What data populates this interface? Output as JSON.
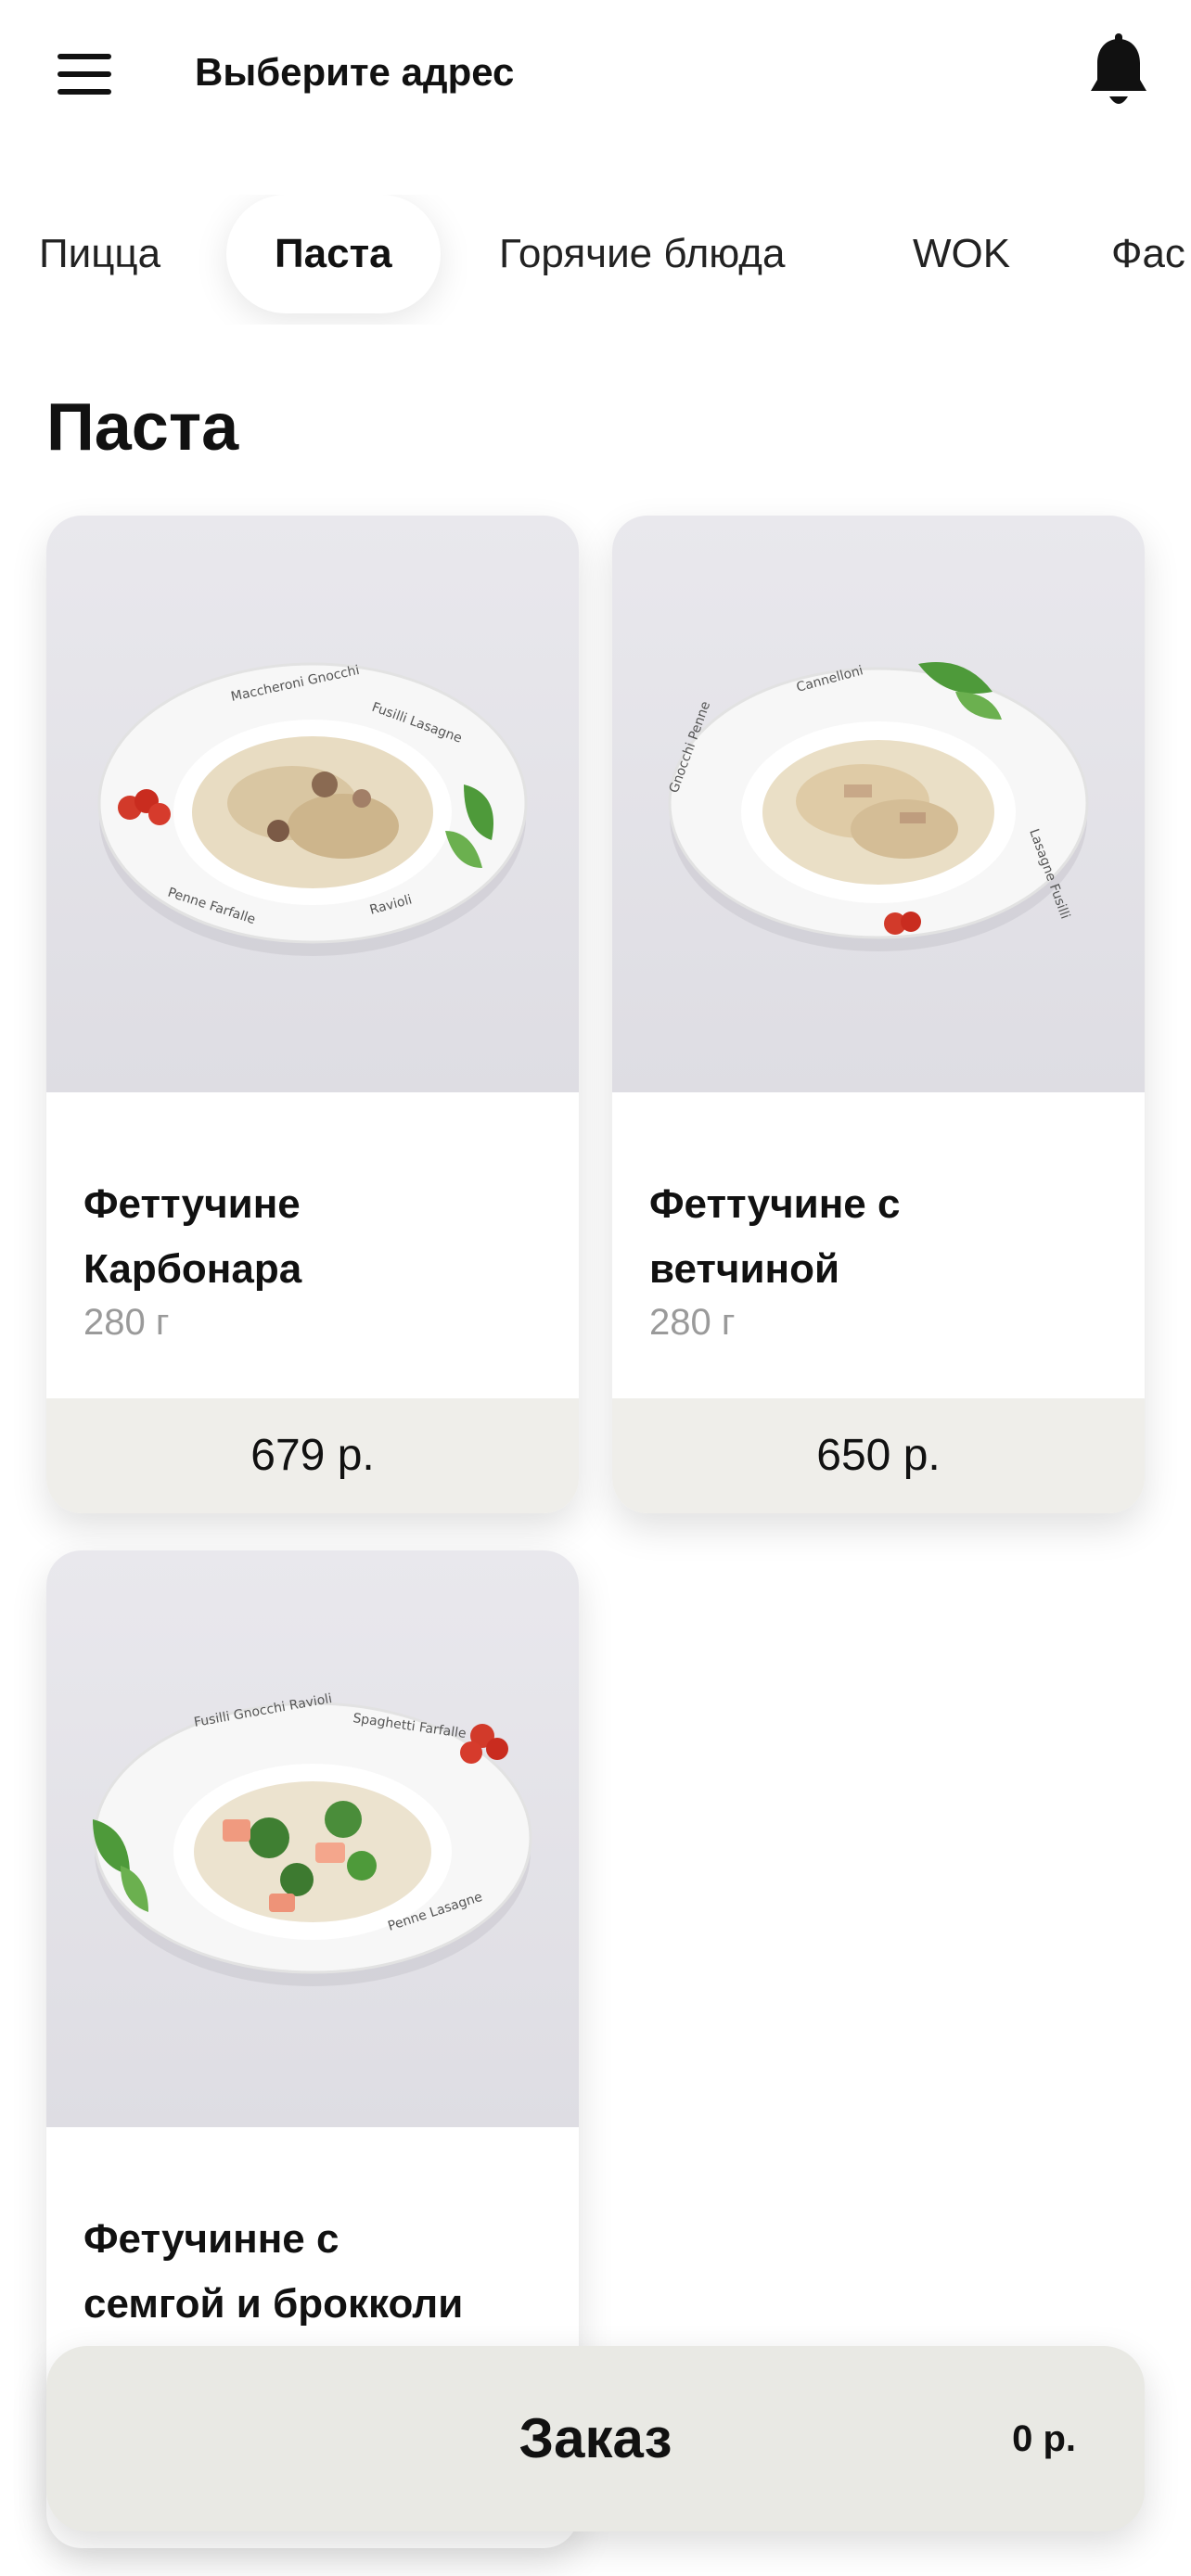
{
  "header": {
    "address_label": "Выберите адрес",
    "menu_icon": "hamburger-menu-icon",
    "bell_icon": "bell-icon"
  },
  "tabs": [
    {
      "label": "Пицца",
      "active": false
    },
    {
      "label": "Паста",
      "active": true
    },
    {
      "label": "Горячие блюда",
      "active": false
    },
    {
      "label": "WOK",
      "active": false
    },
    {
      "label": "Фас",
      "active": false
    }
  ],
  "section": {
    "title": "Паста"
  },
  "products": [
    {
      "name_line1": "Феттучине",
      "name_line2": "Карбонара",
      "weight": "280 г",
      "price": "679 р."
    },
    {
      "name_line1": "Феттучине с",
      "name_line2": "ветчиной",
      "weight": "280 г",
      "price": "650 р."
    },
    {
      "name_line1": "Фетучинне с",
      "name_line2": "семгой и брокколи",
      "weight": "",
      "price": ""
    }
  ],
  "order": {
    "label": "Заказ",
    "total": "0 р."
  },
  "colors": {
    "price_bg": "#efeeea",
    "order_bg": "#e9e9e4",
    "photo_bg": "#e4e3e8"
  }
}
